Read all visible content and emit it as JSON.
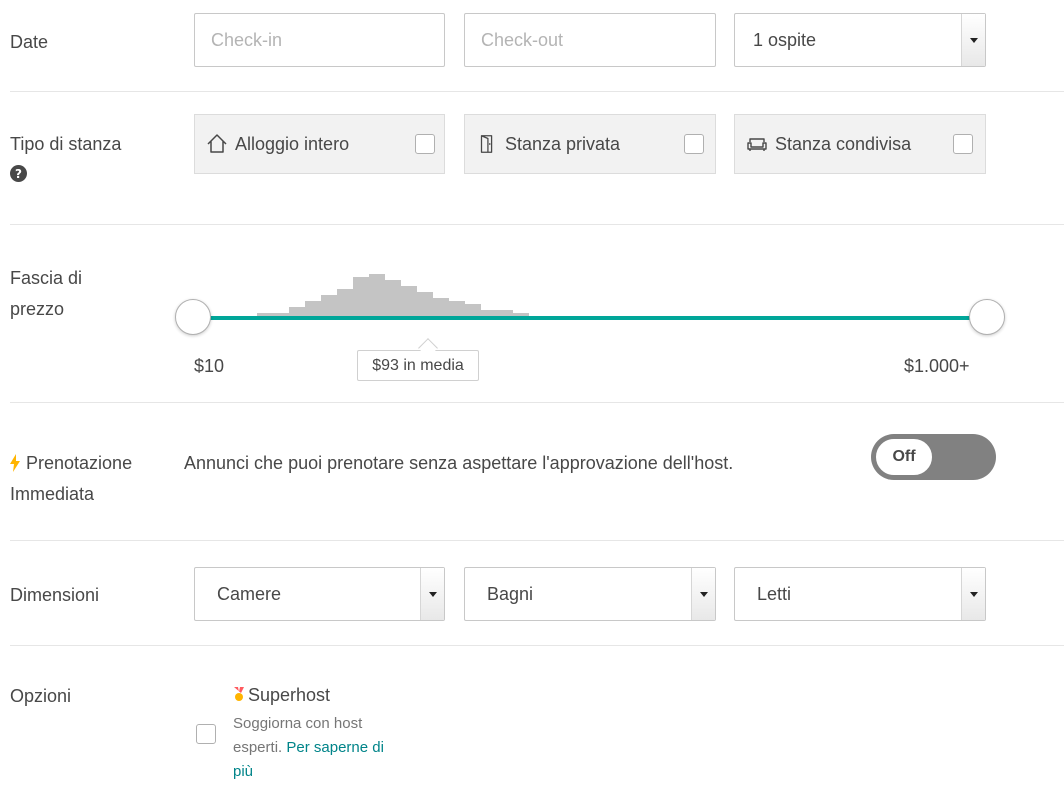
{
  "dates": {
    "label": "Date",
    "checkin_placeholder": "Check-in",
    "checkout_placeholder": "Check-out",
    "guests_value": "1 ospite"
  },
  "room_type": {
    "label": "Tipo di stanza",
    "help_glyph": "?",
    "options": [
      {
        "label": "Alloggio intero",
        "icon": "home-icon",
        "checked": false
      },
      {
        "label": "Stanza privata",
        "icon": "door-icon",
        "checked": false
      },
      {
        "label": "Stanza condivisa",
        "icon": "couch-icon",
        "checked": false
      }
    ]
  },
  "price": {
    "label_line1": "Fascia di",
    "label_line2": "prezzo",
    "min_label": "$10",
    "max_label": "$1.000+",
    "average_label": "$93 in media",
    "histogram": [
      1,
      1,
      3,
      5,
      7,
      9,
      13,
      14,
      12,
      10,
      8,
      6,
      5,
      4,
      2,
      2,
      1
    ],
    "range_min_fraction": 0,
    "range_max_fraction": 1
  },
  "instant_book": {
    "label_line1": "Prenotazione",
    "label_line2": "Immediata",
    "description": "Annunci che puoi prenotare senza aspettare l'approvazione dell'host.",
    "toggle_label": "Off",
    "enabled": false
  },
  "size": {
    "label": "Dimensioni",
    "bedrooms": "Camere",
    "bathrooms": "Bagni",
    "beds": "Letti"
  },
  "options": {
    "label": "Opzioni",
    "superhost_title": "Superhost",
    "superhost_desc_line1": "Soggiorna con host",
    "superhost_desc_line2": "esperti.",
    "learn_more_part1": "Per saperne di",
    "learn_more_part2": "più",
    "superhost_checked": false
  },
  "colors": {
    "accent": "#00a699",
    "link": "#008489",
    "histogram": "#c4c4c4",
    "toggle_off": "#818181",
    "instant_bolt": "#ffb400"
  }
}
